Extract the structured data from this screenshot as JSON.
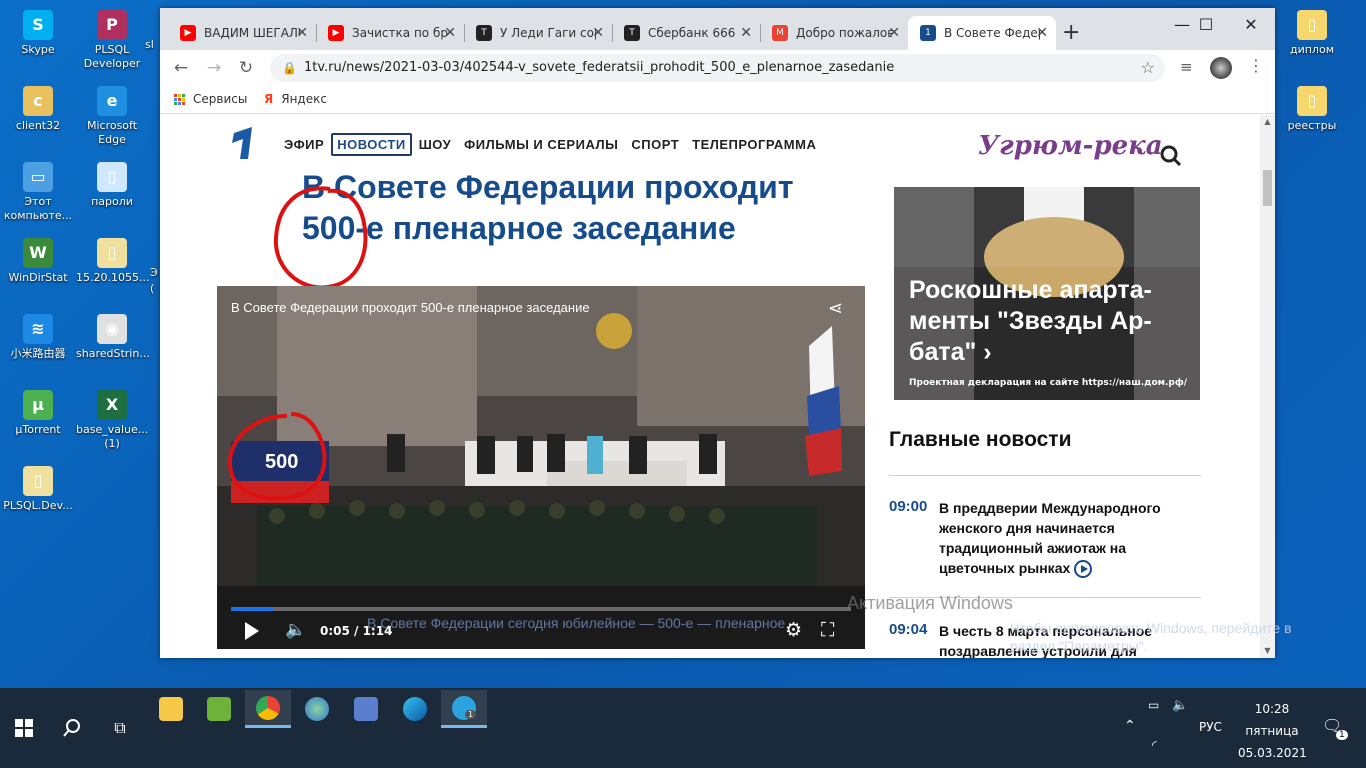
{
  "desktop": {
    "left_icons": [
      {
        "label": "Skype",
        "color": "#00aff0",
        "glyph": "S"
      },
      {
        "label": "PLSQL Developer",
        "color": "#b03060",
        "glyph": "P"
      },
      {
        "label": "client32",
        "color": "#e8c060",
        "glyph": "c"
      },
      {
        "label": "Microsoft Edge",
        "color": "#1f8fe0",
        "glyph": "e"
      },
      {
        "label": "Этот компьюте...",
        "color": "#4aa0e0",
        "glyph": "▭"
      },
      {
        "label": "пароли",
        "color": "#d0e8ff",
        "glyph": "▯"
      },
      {
        "label": "WinDirStat",
        "color": "#3a8a3a",
        "glyph": "W"
      },
      {
        "label": "15.20.1055...",
        "color": "#f0e0a0",
        "glyph": "▯"
      },
      {
        "label": "小米路由器",
        "color": "#1e88e5",
        "glyph": "≋"
      },
      {
        "label": "sharedStrin...",
        "color": "#e0e0e0",
        "glyph": "◉"
      },
      {
        "label": "µTorrent",
        "color": "#4caf50",
        "glyph": "µ"
      },
      {
        "label": "base_value... (1)",
        "color": "#1d6f42",
        "glyph": "X"
      },
      {
        "label": "PLSQL.Dev...",
        "color": "#f0e0a0",
        "glyph": "▯"
      }
    ],
    "right_icons": [
      {
        "label": "диплом",
        "color": "#f5d76e",
        "glyph": "▯"
      },
      {
        "label": "реестры",
        "color": "#f5d76e",
        "glyph": "▯"
      }
    ],
    "partial_labels": [
      "sl",
      "Э",
      "("
    ]
  },
  "browser": {
    "tabs": [
      {
        "title": "ВАДИМ ШЕГАЛОВ",
        "fav_color": "#ff0000",
        "fav_glyph": "▶"
      },
      {
        "title": "Зачистка по бренду",
        "fav_color": "#ff0000",
        "fav_glyph": "▶"
      },
      {
        "title": "У Леди Гаги сорвали",
        "fav_color": "#222222",
        "fav_glyph": "T"
      },
      {
        "title": "Сбербанк 666",
        "fav_color": "#222222",
        "fav_glyph": "T"
      },
      {
        "title": "Добро пожаловать",
        "fav_color": "#ea4335",
        "fav_glyph": "M"
      },
      {
        "title": "В Совете Федерации",
        "fav_color": "#174c8c",
        "fav_glyph": "1"
      }
    ],
    "new_tab": "+",
    "window_controls": {
      "minimize": "—",
      "maximize": "☐",
      "close": "✕"
    },
    "url": "1tv.ru/news/2021-03-03/402544-v_sovete_federatsii_prohodit_500_e_plenarnoe_zasedanie",
    "bookmarks": [
      "Сервисы",
      "Яндекс"
    ]
  },
  "site": {
    "nav": [
      "ЭФИР",
      "НОВОСТИ",
      "ШОУ",
      "ФИЛЬМЫ И СЕРИАЛЫ",
      "СПОРТ",
      "ТЕЛЕПРОГРАММА"
    ],
    "headline_line1": "В Совете Федерации проходит",
    "headline_line2": "500-е пленарное заседание",
    "video": {
      "title": "В Совете Федерации проходит 500-е пленарное заседание",
      "screen_number": "500",
      "time": "0:05 / 1:14",
      "progress": 0.068,
      "ticker": "В Совете Федерации сегодня юбилейное — 500-е — пленарное"
    },
    "ad": {
      "logo": "Угрюм-река",
      "text": "Роскошные апарта-менты \"Звезды Ар-бата\" ›",
      "note": "Проектная декларация на сайте https://наш.дом.рф/"
    },
    "main_news_title": "Главные новости",
    "news": [
      {
        "time": "09:00",
        "text": "В преддверии Международного женского дня начинается традиционный ажиотаж на цветочных рынках"
      },
      {
        "time": "09:04",
        "text": "В честь 8 марта персональное поздравление устроили для"
      }
    ],
    "watermark_title": "Активация Windows",
    "watermark_sub": "Чтобы активировать Windows, перейдите в раздел \"Параметры\"."
  },
  "taskbar": {
    "language": "РУС",
    "time": "10:28",
    "day": "пятница",
    "date": "05.03.2021",
    "notification_count": "1",
    "telegram_badge": "1"
  }
}
